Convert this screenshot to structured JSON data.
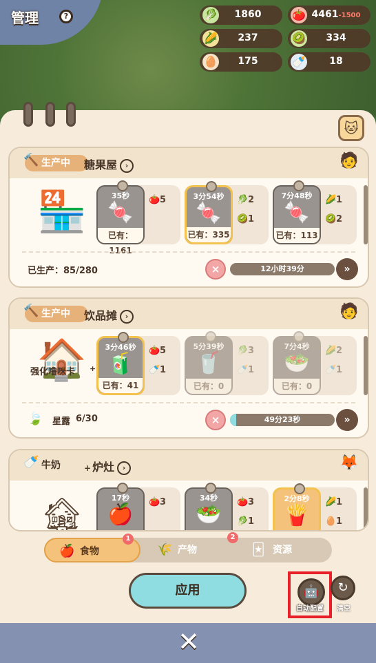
{
  "header": {
    "title": "管理",
    "help_symbol": "?"
  },
  "resources": [
    {
      "icon": "lettuce-icon",
      "glyph": "🥬",
      "value": "1860",
      "extra": ""
    },
    {
      "icon": "tomato-icon",
      "glyph": "🍅",
      "value": "4461",
      "extra": "-1500"
    },
    {
      "icon": "corn-icon",
      "glyph": "🌽",
      "value": "237",
      "extra": ""
    },
    {
      "icon": "kiwi-icon",
      "glyph": "🥝",
      "value": "334",
      "extra": ""
    },
    {
      "icon": "egg-icon",
      "glyph": "🥚",
      "value": "175",
      "extra": ""
    },
    {
      "icon": "milk-bottle-icon",
      "glyph": "🍼",
      "value": "18",
      "extra": ""
    }
  ],
  "cards": [
    {
      "status": "生产中",
      "name": "糖果屋",
      "products": [
        {
          "time": "35秒",
          "owned": "已有：1161",
          "glyph": "🍬",
          "ingredients": [
            {
              "glyph": "🍅",
              "qty": "5"
            }
          ],
          "selected": false,
          "locked": false
        },
        {
          "time": "3分54秒",
          "owned": "已有：335",
          "glyph": "🍬",
          "ingredients": [
            {
              "glyph": "🥬",
              "qty": "2"
            },
            {
              "glyph": "🥝",
              "qty": "1"
            }
          ],
          "selected": true,
          "locked": false
        },
        {
          "time": "7分48秒",
          "owned": "已有：113",
          "glyph": "🍬",
          "ingredients": [
            {
              "glyph": "🌽",
              "qty": "1"
            },
            {
              "glyph": "🥝",
              "qty": "2"
            }
          ],
          "selected": false,
          "locked": false
        }
      ],
      "produced": "已生产：85/280",
      "timer": "12小时39分",
      "progress": 0
    },
    {
      "status": "生产中",
      "name": "饮品摊",
      "products": [
        {
          "time": "3分46秒",
          "owned": "已有：41",
          "glyph": "🧃",
          "ingredients": [
            {
              "glyph": "🍅",
              "qty": "5"
            },
            {
              "glyph": "🍼",
              "qty": "1"
            }
          ],
          "selected": true,
          "locked": false
        },
        {
          "time": "5分39秒",
          "owned": "已有：0",
          "glyph": "🥤",
          "ingredients": [
            {
              "glyph": "🥬",
              "qty": "3"
            },
            {
              "glyph": "🍼",
              "qty": "1"
            }
          ],
          "selected": false,
          "locked": true
        },
        {
          "time": "7分4秒",
          "owned": "已有：0",
          "glyph": "🥗",
          "ingredients": [
            {
              "glyph": "🌽",
              "qty": "2"
            },
            {
              "glyph": "🍼",
              "qty": "1"
            }
          ],
          "selected": false,
          "locked": true
        }
      ],
      "boost_left": "强化噜咪卡",
      "boost_plus": "+1",
      "star_label": "星露",
      "star_value": "6/30",
      "timer": "49分23秒",
      "progress": 0.06
    },
    {
      "status": "牛奶",
      "status_plus": "+",
      "name": "炉灶",
      "products": [
        {
          "time": "17秒",
          "glyph": "🍎",
          "ingredients": [
            {
              "glyph": "🍅",
              "qty": "3"
            }
          ]
        },
        {
          "time": "34秒",
          "glyph": "🥗",
          "ingredients": [
            {
              "glyph": "🍅",
              "qty": "3"
            },
            {
              "glyph": "🥬",
              "qty": "1"
            }
          ]
        },
        {
          "time": "2分8秒",
          "glyph": "🍟",
          "ingredients": [
            {
              "glyph": "🌽",
              "qty": "1"
            },
            {
              "glyph": "🥚",
              "qty": "1"
            }
          ]
        }
      ]
    }
  ],
  "tabs": [
    {
      "label": "食物",
      "glyph": "🍎",
      "badge": "1"
    },
    {
      "label": "产物",
      "glyph": "🌾",
      "badge": "2"
    },
    {
      "label": "资源",
      "glyph": "🃏",
      "badge": ""
    }
  ],
  "buttons": {
    "apply": "应用",
    "auto": "自动配置",
    "clear": "清空",
    "close": "✕",
    "cancel": "×",
    "fast_forward": "»"
  },
  "colors": {
    "highlight": "#e8202a",
    "apply_button": "#8fdde0",
    "panel": "#f7ecdc"
  }
}
